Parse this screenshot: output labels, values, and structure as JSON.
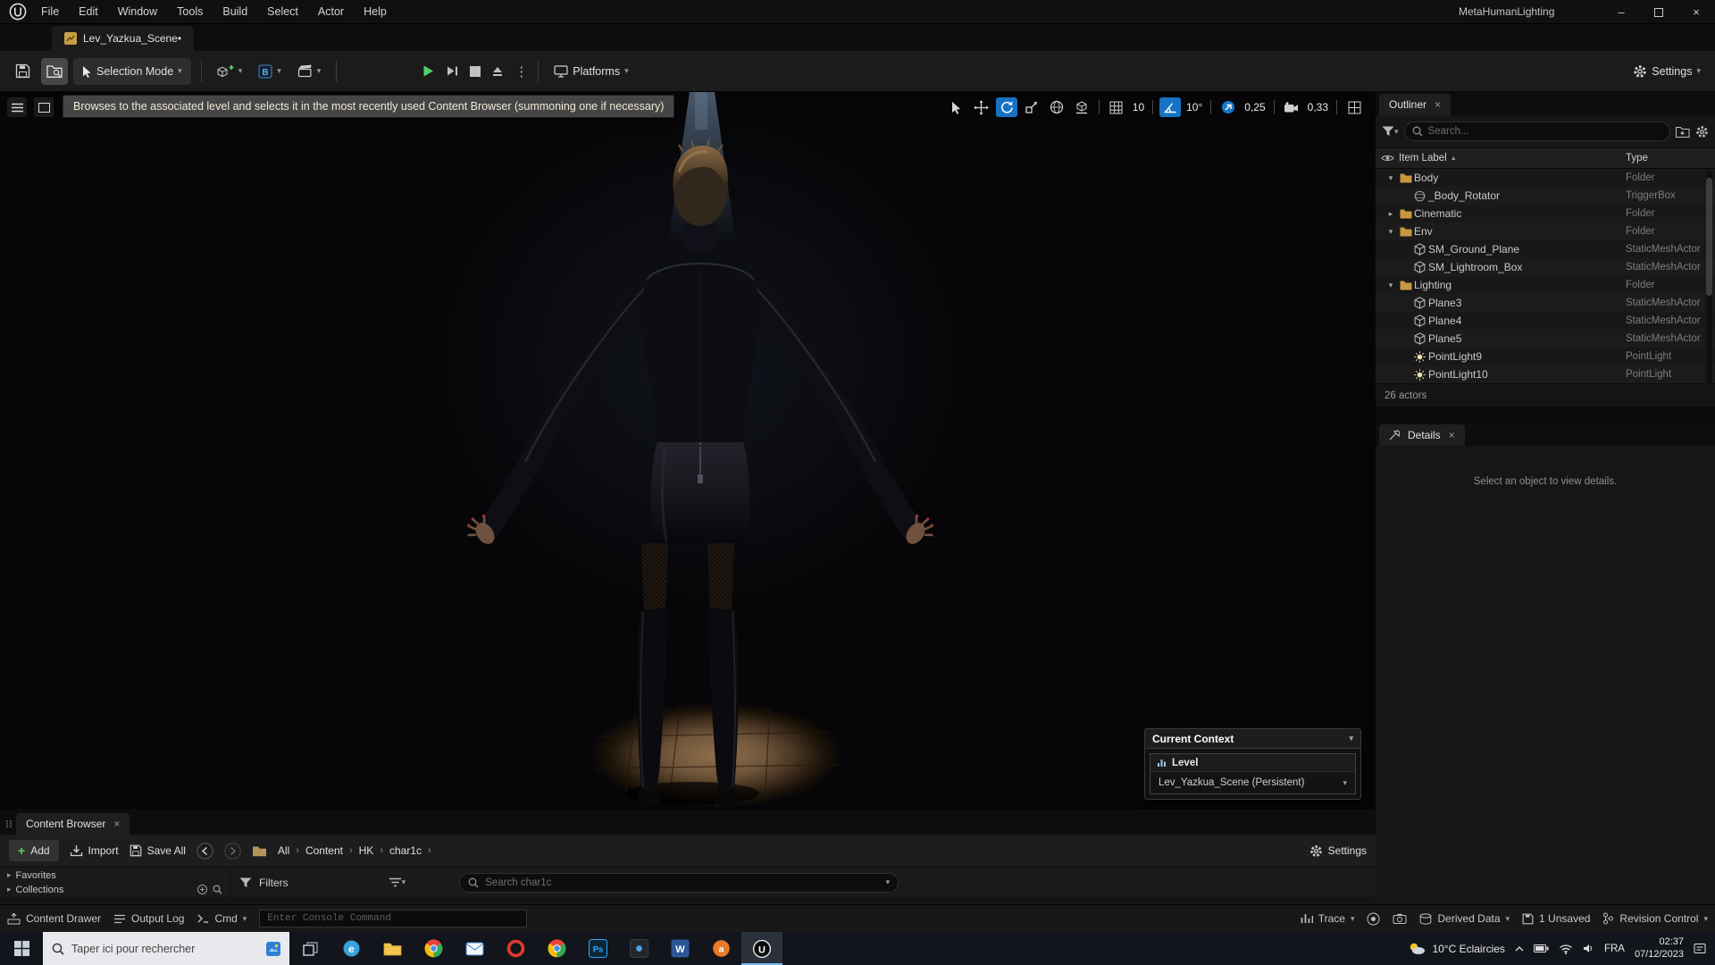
{
  "window": {
    "title": "MetaHumanLighting"
  },
  "menubar": {
    "items": [
      "File",
      "Edit",
      "Window",
      "Tools",
      "Build",
      "Select",
      "Actor",
      "Help"
    ]
  },
  "asset_tab": {
    "label": "Lev_Yazkua_Scene•"
  },
  "toolbar": {
    "selection_mode_label": "Selection Mode",
    "platforms_label": "Platforms",
    "settings_label": "Settings"
  },
  "viewport": {
    "tooltip": "Browses to the associated level and selects it in the most recently used Content Browser (summoning one if necessary)",
    "grid_snap_value": "10",
    "rotation_snap_value": "10°",
    "scale_snap_value": "0,25",
    "camera_speed_value": "0,33",
    "current_context": {
      "title": "Current Context",
      "section_label": "Level",
      "level_value": "Lev_Yazkua_Scene (Persistent)"
    }
  },
  "outliner": {
    "tab_label": "Outliner",
    "search_placeholder": "Search...",
    "column_item_label": "Item Label",
    "column_type": "Type",
    "rows": [
      {
        "label": "Body",
        "type": "Folder",
        "icon": "folder",
        "indent": 0,
        "expander": "open"
      },
      {
        "label": "_Body_Rotator",
        "type": "TriggerBox",
        "icon": "trigger",
        "indent": 1
      },
      {
        "label": "Cinematic",
        "type": "Folder",
        "icon": "folder",
        "indent": 0,
        "expander": "closed"
      },
      {
        "label": "Env",
        "type": "Folder",
        "icon": "folder",
        "indent": 0,
        "expander": "open"
      },
      {
        "label": "SM_Ground_Plane",
        "type": "StaticMeshActor",
        "icon": "mesh",
        "indent": 1
      },
      {
        "label": "SM_Lightroom_Box",
        "type": "StaticMeshActor",
        "icon": "mesh",
        "indent": 1
      },
      {
        "label": "Lighting",
        "type": "Folder",
        "icon": "folder",
        "indent": 0,
        "expander": "open"
      },
      {
        "label": "Plane3",
        "type": "StaticMeshActor",
        "icon": "mesh",
        "indent": 1
      },
      {
        "label": "Plane4",
        "type": "StaticMeshActor",
        "icon": "mesh",
        "indent": 1
      },
      {
        "label": "Plane5",
        "type": "StaticMeshActor",
        "icon": "mesh",
        "indent": 1
      },
      {
        "label": "PointLight9",
        "type": "PointLight",
        "icon": "light",
        "indent": 1
      },
      {
        "label": "PointLight10",
        "type": "PointLight",
        "icon": "light",
        "indent": 1
      }
    ],
    "footer": "26 actors"
  },
  "details": {
    "tab_label": "Details",
    "empty_text": "Select an object to view details."
  },
  "content_browser": {
    "tab_label": "Content Browser",
    "add_label": "Add",
    "import_label": "Import",
    "save_all_label": "Save All",
    "breadcrumb": [
      "All",
      "Content",
      "HK",
      "char1c"
    ],
    "settings_label": "Settings",
    "favorites_label": "Favorites",
    "collections_label": "Collections",
    "filters_label": "Filters",
    "search_placeholder": "Search char1c"
  },
  "status_bar": {
    "content_drawer_label": "Content Drawer",
    "output_log_label": "Output Log",
    "cmd_label": "Cmd",
    "console_placeholder": "Enter Console Command",
    "trace_label": "Trace",
    "derived_data_label": "Derived Data",
    "unsaved_label": "1 Unsaved",
    "revision_control_label": "Revision Control"
  },
  "taskbar": {
    "search_placeholder": "Taper ici pour rechercher",
    "apps": [
      {
        "icon": "task-view"
      },
      {
        "icon": "edge",
        "label": "e"
      },
      {
        "icon": "file-explorer"
      },
      {
        "icon": "chrome"
      },
      {
        "icon": "mail"
      },
      {
        "icon": "opera",
        "label": "O"
      },
      {
        "icon": "chrome"
      },
      {
        "icon": "photoshop",
        "label": "Ps"
      },
      {
        "icon": "app-dark"
      },
      {
        "icon": "word",
        "label": "W"
      },
      {
        "icon": "app-orange",
        "label": "a"
      },
      {
        "icon": "unreal",
        "label": "U",
        "active": true
      }
    ],
    "tray": {
      "weather": "10°C Eclaircies",
      "language": "FRA",
      "time": "02:37",
      "date": "07/12/2023"
    }
  },
  "colors": {
    "accent_blue": "#1673c4",
    "play_green": "#4fd26b",
    "folder_yellow": "#c9973f"
  }
}
